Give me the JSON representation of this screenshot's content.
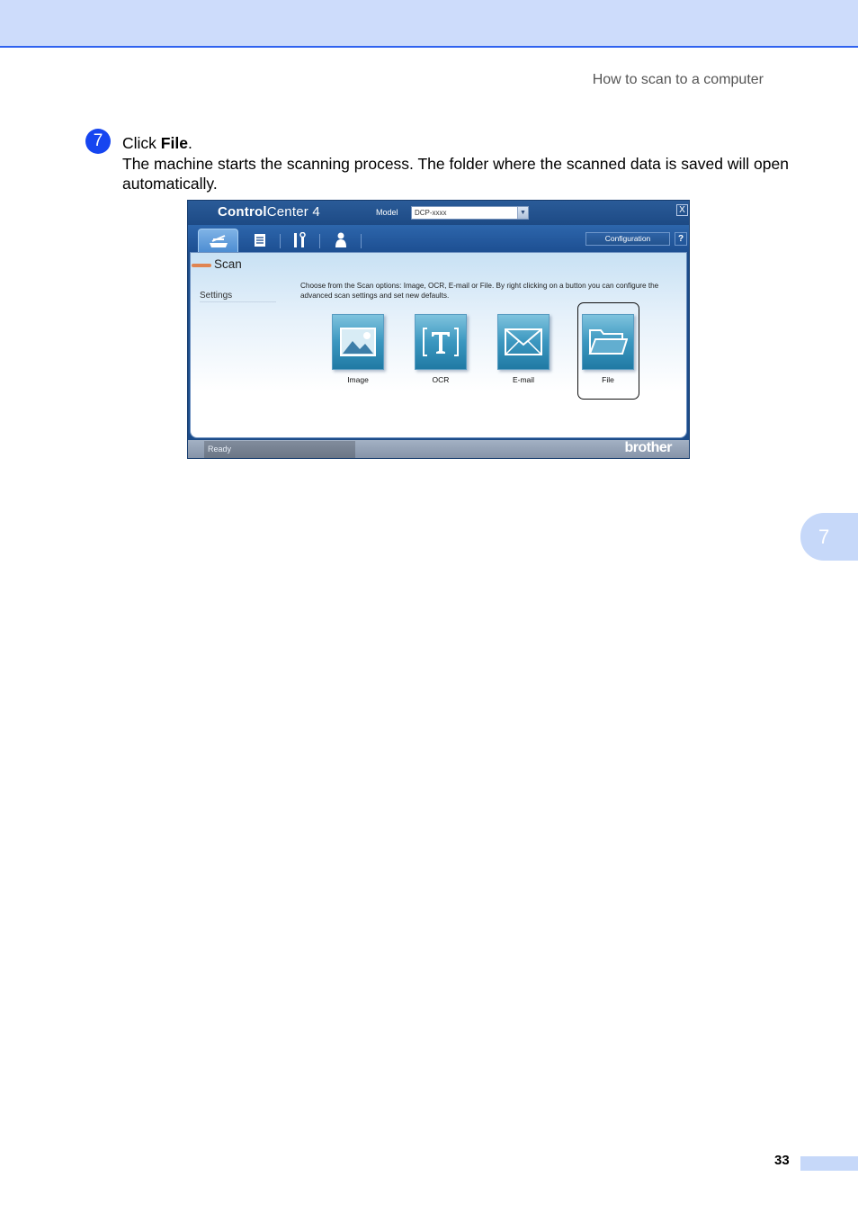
{
  "header": {
    "running_title": "How to scan to a computer"
  },
  "step": {
    "number": "7",
    "intro_prefix": "Click ",
    "intro_bold": "File",
    "intro_suffix": ".",
    "description": "The machine starts the scanning process. The folder where the scanned data is saved will open automatically."
  },
  "app": {
    "title_bold": "Control",
    "title_rest": "Center 4",
    "model_label": "Model",
    "model_value": "DCP-xxxx",
    "close_label": "X",
    "configuration_label": "Configuration",
    "help_label": "?",
    "section_title": "Scan",
    "settings_label": "Settings",
    "description": "Choose from the Scan options: Image, OCR, E-mail or File. By right clicking on a button you can configure the advanced scan settings and set new defaults.",
    "buttons": [
      {
        "label": "Image",
        "icon": "image-icon"
      },
      {
        "label": "OCR",
        "icon": "ocr-icon"
      },
      {
        "label": "E-mail",
        "icon": "email-icon"
      },
      {
        "label": "File",
        "icon": "folder-icon"
      }
    ],
    "status_text": "Ready",
    "brand": "brother",
    "highlighted_button": "File"
  },
  "chapter_tab": "7",
  "page_number": "33",
  "colors": {
    "header_band": "#cddcfb",
    "header_rule": "#2f62f0",
    "step_badge": "#1645f0",
    "window_frame": "#1c4c8a",
    "scan_marker": "#e08451"
  }
}
